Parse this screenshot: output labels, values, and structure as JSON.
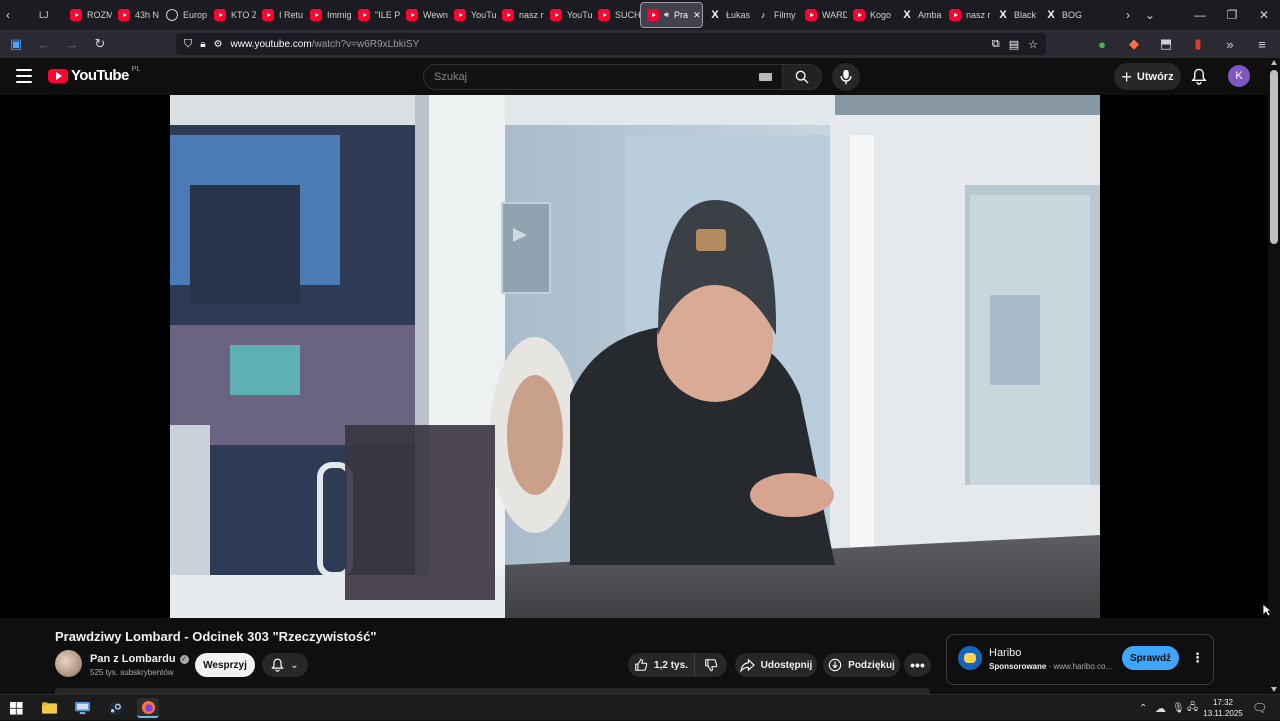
{
  "browser": {
    "tabs": [
      {
        "label": "LJ",
        "icon": "generic"
      },
      {
        "label": "ROZM",
        "icon": "youtube"
      },
      {
        "label": "43h N",
        "icon": "youtube"
      },
      {
        "label": "Europ",
        "icon": "globe"
      },
      {
        "label": "KTO Z",
        "icon": "youtube"
      },
      {
        "label": "I Retu",
        "icon": "youtube"
      },
      {
        "label": "Immig",
        "icon": "youtube"
      },
      {
        "label": "\"ILE P",
        "icon": "youtube"
      },
      {
        "label": "Wewn",
        "icon": "youtube"
      },
      {
        "label": "YouTu",
        "icon": "youtube"
      },
      {
        "label": "nasz n",
        "icon": "youtube"
      },
      {
        "label": "YouTu",
        "icon": "youtube"
      },
      {
        "label": "SUCH",
        "icon": "youtube"
      },
      {
        "label": "Pra",
        "icon": "youtube",
        "active": true
      },
      {
        "label": "Łukas",
        "icon": "x"
      },
      {
        "label": "Filmy",
        "icon": "tiktok"
      },
      {
        "label": "WARD",
        "icon": "youtube"
      },
      {
        "label": "Kogo",
        "icon": "youtube"
      },
      {
        "label": "Amba",
        "icon": "x"
      },
      {
        "label": "nasz r",
        "icon": "youtube"
      },
      {
        "label": "Black",
        "icon": "x"
      },
      {
        "label": "BOG",
        "icon": "x"
      }
    ],
    "url_host": "www.youtube.com",
    "url_path": "/watch?v=w6R9xLbkiSY"
  },
  "youtube": {
    "logo_text": "YouTube",
    "country": "PL",
    "search_placeholder": "Szukaj",
    "create_label": "Utwórz",
    "avatar_letter": "K",
    "avatar_color": "#7e57c2"
  },
  "video": {
    "title": "Prawdziwy Lombard - Odcinek 303 \"Rzeczywistość\"",
    "channel_name": "Pan z Lombardu",
    "subscribers": "525 tys. subskrybentów",
    "support_label": "Wesprzyj",
    "likes": "1,2 tys.",
    "share_label": "Udostępnij",
    "thanks_label": "Podziękuj"
  },
  "ad": {
    "brand": "Haribo",
    "sponsored_label": "Sponsorowane",
    "domain": "www.haribo.co...",
    "cta": "Sprawdź"
  },
  "taskbar": {
    "time": "17:32",
    "date": "13.11.2025"
  }
}
